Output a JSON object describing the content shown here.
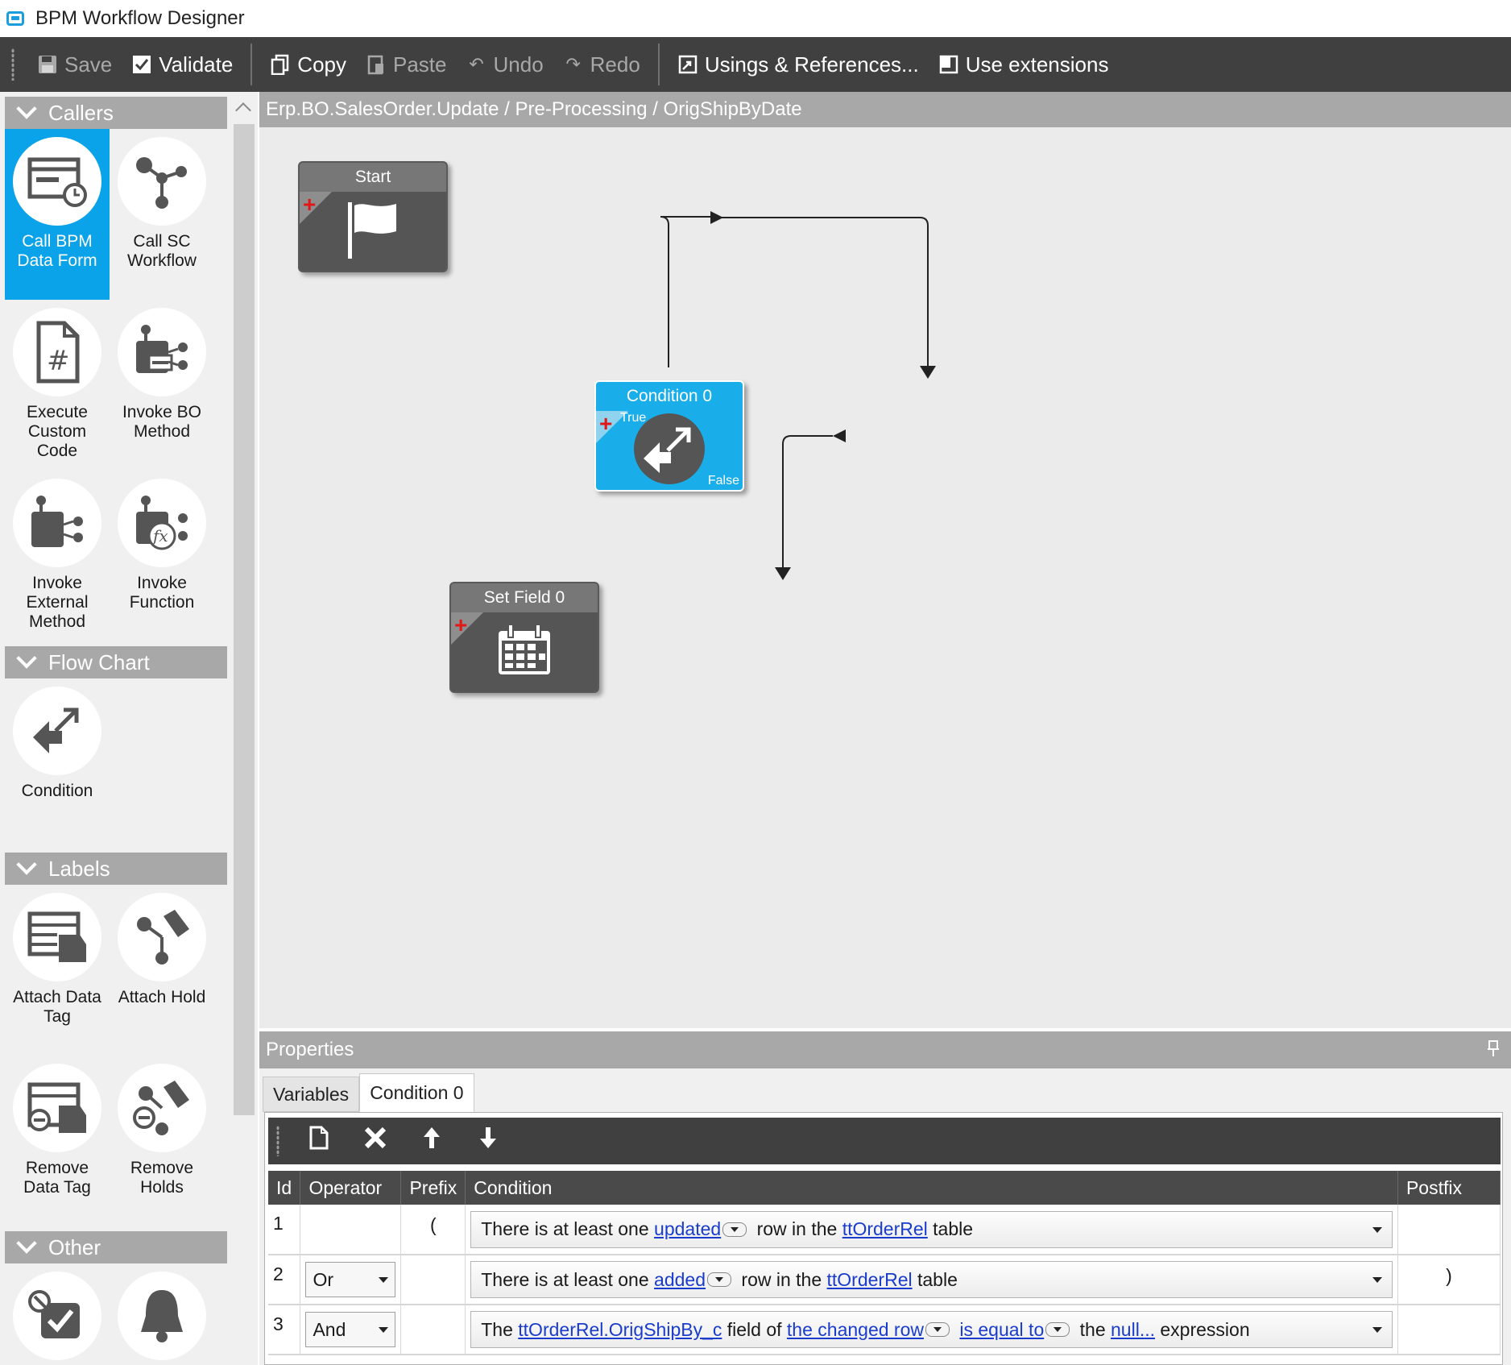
{
  "window": {
    "title": "BPM Workflow Designer"
  },
  "toolbar": {
    "save": "Save",
    "validate": "Validate",
    "copy": "Copy",
    "paste": "Paste",
    "undo": "Undo",
    "redo": "Redo",
    "usings": "Usings & References...",
    "extensions": "Use extensions"
  },
  "palette": {
    "callers": {
      "header": "Callers",
      "items": [
        {
          "label": "Call BPM Data Form",
          "icon": "form-icon",
          "selected": true
        },
        {
          "label": "Call SC Workflow",
          "icon": "workflow-icon"
        },
        {
          "label": "Execute Custom Code",
          "icon": "code-file-icon"
        },
        {
          "label": "Invoke BO Method",
          "icon": "bo-method-icon"
        },
        {
          "label": "Invoke External Method",
          "icon": "external-method-icon"
        },
        {
          "label": "Invoke Function",
          "icon": "function-icon"
        }
      ]
    },
    "flowchart": {
      "header": "Flow Chart",
      "items": [
        {
          "label": "Condition",
          "icon": "condition-icon"
        }
      ]
    },
    "labels": {
      "header": "Labels",
      "items": [
        {
          "label": "Attach Data Tag",
          "icon": "data-tag-icon"
        },
        {
          "label": "Attach Hold",
          "icon": "hold-icon"
        },
        {
          "label": "Remove Data Tag",
          "icon": "remove-data-tag-icon"
        },
        {
          "label": "Remove Holds",
          "icon": "remove-hold-icon"
        }
      ]
    },
    "other": {
      "header": "Other",
      "items": [
        {
          "label": "",
          "icon": "enable-icon"
        },
        {
          "label": "",
          "icon": "notify-bell-icon"
        }
      ]
    }
  },
  "canvas": {
    "breadcrumb": "Erp.BO.SalesOrder.Update / Pre-Processing / OrigShipByDate",
    "nodes": {
      "start": {
        "title": "Start",
        "icon": "flag-icon"
      },
      "condition": {
        "title": "Condition 0",
        "true_label": "True",
        "false_label": "False",
        "icon": "condition-icon"
      },
      "setfield": {
        "title": "Set Field 0",
        "icon": "calendar-icon"
      }
    }
  },
  "properties": {
    "header": "Properties",
    "tabs": [
      {
        "label": "Variables"
      },
      {
        "label": "Condition 0",
        "active": true
      }
    ],
    "columns": {
      "id": "Id",
      "operator": "Operator",
      "prefix": "Prefix",
      "condition": "Condition",
      "postfix": "Postfix"
    },
    "rows": [
      {
        "id": "1",
        "operator": "",
        "prefix": "(",
        "postfix": "",
        "parts": {
          "t1": "There is at least one",
          "l1": "updated",
          "t2": "row in the",
          "l2": "ttOrderRel",
          "t3": "table"
        }
      },
      {
        "id": "2",
        "operator": "Or",
        "prefix": "",
        "postfix": ")",
        "parts": {
          "t1": "There is at least one",
          "l1": "added",
          "t2": "row in the",
          "l2": "ttOrderRel",
          "t3": "table"
        }
      },
      {
        "id": "3",
        "operator": "And",
        "prefix": "",
        "postfix": "",
        "parts": {
          "t1": "The",
          "l1": "ttOrderRel.OrigShipBy_c",
          "t2": "field of",
          "l2": "the changed row",
          "l3": "is equal to",
          "t3": "the",
          "l4": "null...",
          "t4": "expression"
        }
      }
    ]
  }
}
